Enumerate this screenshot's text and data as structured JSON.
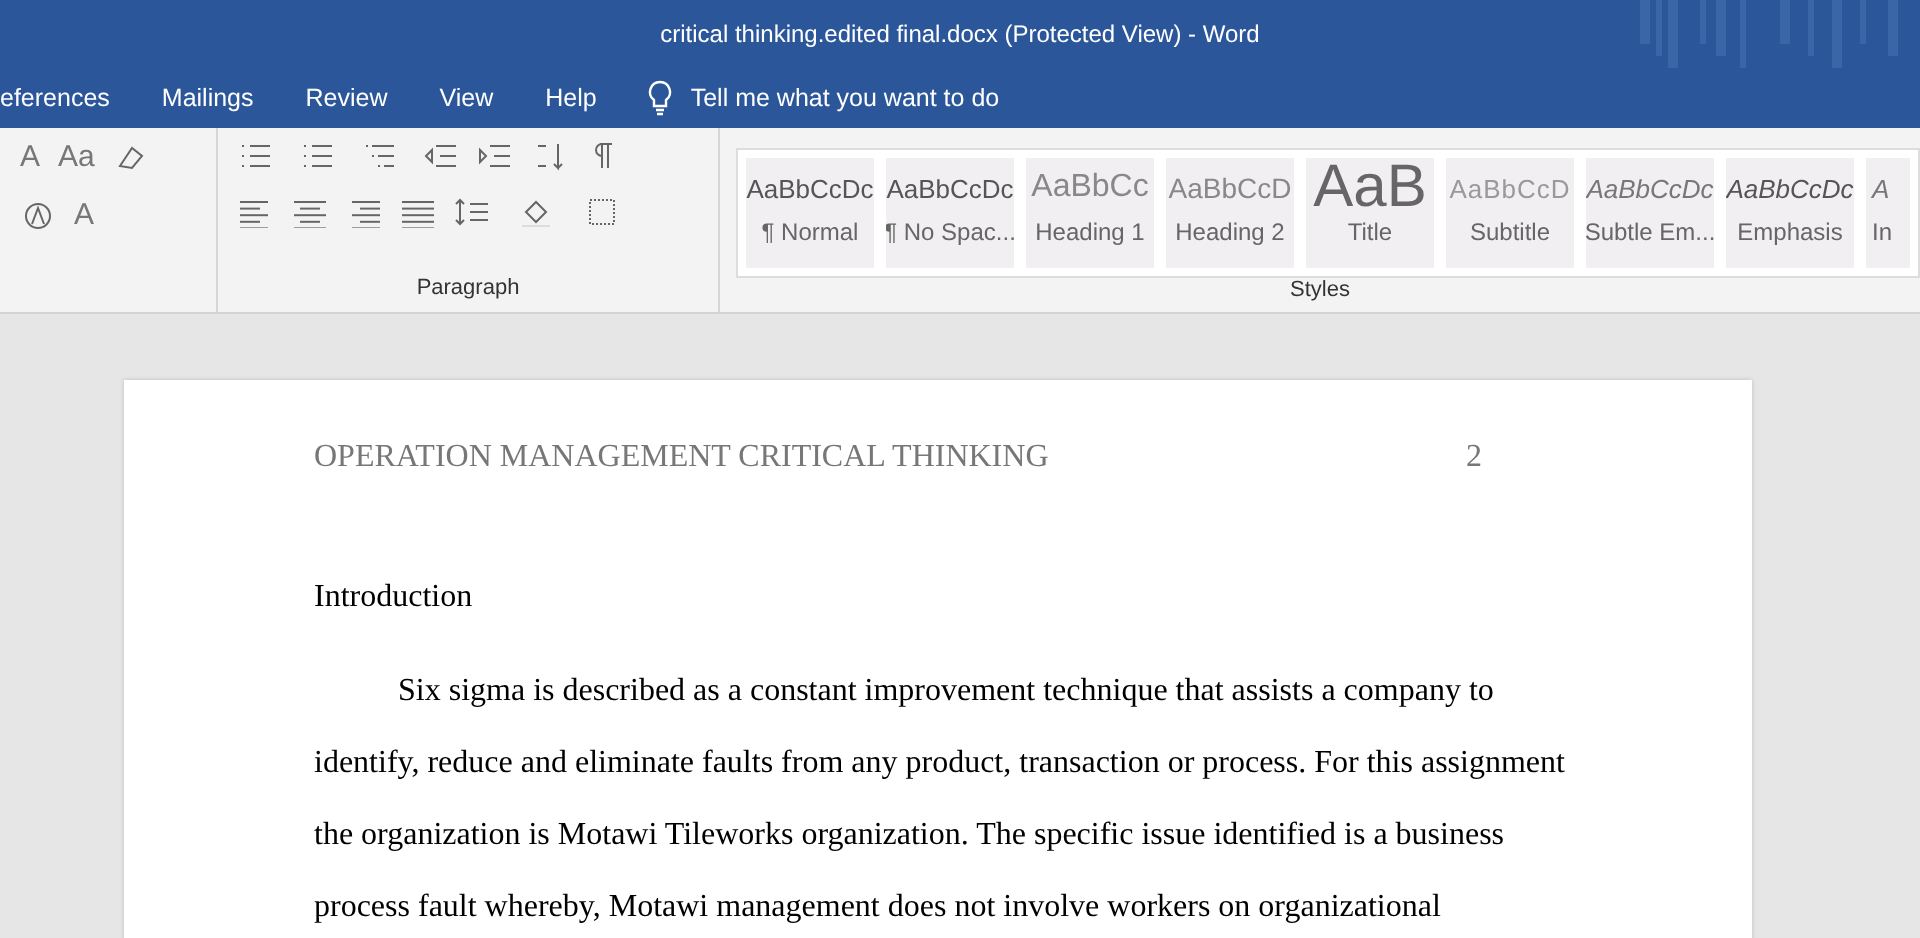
{
  "window": {
    "title": "critical thinking.edited final.docx (Protected View)  -  Word"
  },
  "tabs": [
    {
      "label": "eferences",
      "selected": false
    },
    {
      "label": "Mailings",
      "selected": false
    },
    {
      "label": "Review",
      "selected": false
    },
    {
      "label": "View",
      "selected": false
    },
    {
      "label": "Help",
      "selected": false
    }
  ],
  "tell_me": {
    "placeholder": "Tell me what you want to do"
  },
  "font_group": {
    "controls": [
      "A",
      "Aa",
      "A"
    ]
  },
  "paragraph_group": {
    "label": "Paragraph"
  },
  "styles_group": {
    "label": "Styles",
    "styles": [
      {
        "preview": "AaBbCcDc",
        "name": "¶ Normal",
        "kind": "normal"
      },
      {
        "preview": "AaBbCcDc",
        "name": "¶ No Spac...",
        "kind": "normal"
      },
      {
        "preview": "AaBbCc",
        "name": "Heading 1",
        "kind": "heading1"
      },
      {
        "preview": "AaBbCcD",
        "name": "Heading 2",
        "kind": "heading2"
      },
      {
        "preview": "AaB",
        "name": "Title",
        "kind": "title"
      },
      {
        "preview": "AaBbCcD",
        "name": "Subtitle",
        "kind": "subtitle"
      },
      {
        "preview": "AaBbCcDc",
        "name": "Subtle Em...",
        "kind": "italic"
      },
      {
        "preview": "AaBbCcDc",
        "name": "Emphasis",
        "kind": "emphasis"
      },
      {
        "preview": "A",
        "name": "In",
        "kind": "italic"
      }
    ]
  },
  "document": {
    "header": {
      "title": "OPERATION MANAGEMENT CRITICAL THINKING",
      "page_number": "2"
    },
    "heading": "Introduction",
    "paragraph": "Six sigma is described as a constant improvement technique that assists a company to identify, reduce and eliminate faults from any product, transaction or process. For this assignment the organization is Motawi Tileworks organization. The specific issue identified is a business process fault whereby, Motawi management does not involve workers on organizational"
  }
}
